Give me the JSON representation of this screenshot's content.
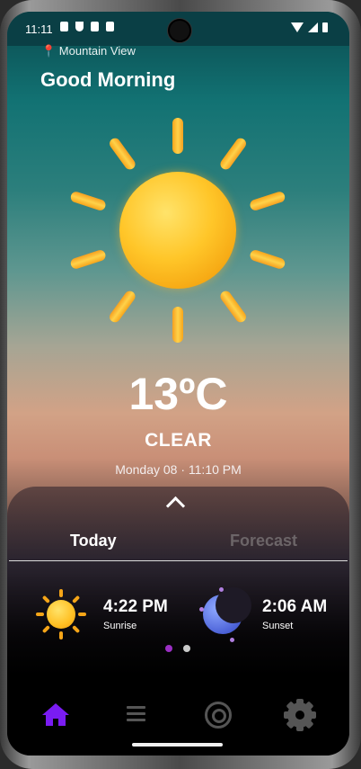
{
  "status_bar": {
    "time": "11:11",
    "left_icons": [
      "notification-icon",
      "vpn-shield-icon",
      "sim-icon",
      "app-a-icon"
    ],
    "right_icons": [
      "wifi-icon",
      "signal-icon",
      "battery-icon"
    ]
  },
  "header": {
    "location": "📍 Mountain View",
    "greeting": "Good Morning"
  },
  "current": {
    "icon": "sun-icon",
    "temperature": "13ºC",
    "condition": "CLEAR",
    "datetime": "Monday 08 · 11:10 PM"
  },
  "sheet": {
    "tabs": [
      {
        "label": "Today",
        "active": true
      },
      {
        "label": "Forecast",
        "active": false
      }
    ],
    "sun": {
      "time": "4:22 PM",
      "label": "Sunrise",
      "icon": "sun-icon"
    },
    "moon": {
      "time": "2:06 AM",
      "label": "Sunset",
      "icon": "moon-icon"
    },
    "page_indicator": {
      "count": 2,
      "active": 1
    }
  },
  "nav": {
    "items": [
      {
        "name": "home",
        "icon": "home-icon",
        "active": true
      },
      {
        "name": "list",
        "icon": "list-icon",
        "active": false
      },
      {
        "name": "radar",
        "icon": "radar-icon",
        "active": false
      },
      {
        "name": "settings",
        "icon": "gear-icon",
        "active": false
      }
    ]
  },
  "colors": {
    "accent": "#7a1cf2",
    "inactive_icon": "#555555",
    "page_dot_active": "#9b2fc4"
  }
}
